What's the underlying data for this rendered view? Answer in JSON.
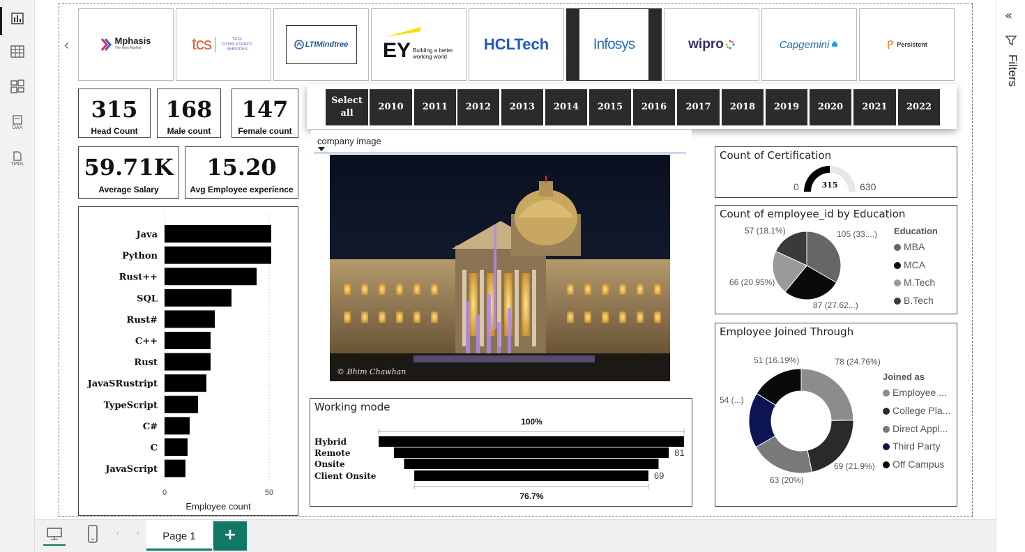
{
  "left_rail": {
    "items": [
      {
        "icon": "report-view-icon"
      },
      {
        "icon": "table-view-icon"
      },
      {
        "icon": "model-view-icon"
      },
      {
        "icon": "dax-query-icon",
        "label": "DAX"
      },
      {
        "icon": "tmdl-view-icon",
        "label": "TMDL"
      }
    ]
  },
  "right_pane": {
    "label": "Filters"
  },
  "logos": [
    "Mphasis",
    "The Next Applied",
    "tcs",
    "TATA CONSULTANCY SERVICES",
    "LTIMindtree",
    "EY",
    "Building a better working world",
    "HCLTech",
    "Infosys",
    "wipro",
    "Capgemini",
    "Persistent"
  ],
  "kpis": [
    {
      "value": "315",
      "label": "Head Count"
    },
    {
      "value": "168",
      "label": "Male count"
    },
    {
      "value": "147",
      "label": "Female count"
    },
    {
      "value": "59.71K",
      "label": "Average Salary"
    },
    {
      "value": "15.20",
      "label": "Avg Employee experience"
    }
  ],
  "year_slicer": {
    "select_all": "Select all",
    "years": [
      "2010",
      "2011",
      "2012",
      "2013",
      "2014",
      "2015",
      "2016",
      "2017",
      "2018",
      "2019",
      "2020",
      "2021",
      "2022"
    ]
  },
  "image_slicer": {
    "label": "company image",
    "watermark": "© Bhim Chawhan"
  },
  "languages_chart": {
    "chart_data": {
      "type": "bar",
      "orientation": "horizontal",
      "categories": [
        "Java",
        "Python",
        "Rust++",
        "SQL",
        "Rust#",
        "C++",
        "Rust",
        "JavaSRustript",
        "TypeScript",
        "C#",
        "C",
        "JavaScript"
      ],
      "values": [
        51,
        51,
        44,
        32,
        24,
        22,
        22,
        20,
        16,
        12,
        11,
        10
      ],
      "xlabel": "Employee count",
      "xticks": [
        "0",
        "50"
      ],
      "xlim": [
        0,
        55
      ],
      "grid": false
    }
  },
  "working_mode": {
    "title": "Working mode",
    "top_pct": "100%",
    "bottom_pct": "76.7%",
    "chart_data": {
      "type": "bar",
      "subtype": "funnel",
      "categories": [
        "Hybrid",
        "Remote",
        "Onsite",
        "Client Onsite"
      ],
      "values": [
        90,
        81,
        75,
        69
      ],
      "data_labels": [
        "",
        "81",
        "",
        "69"
      ]
    }
  },
  "certification": {
    "title": "Count of Certification",
    "min": "0",
    "max": "630",
    "value": "315",
    "chart_data": {
      "type": "gauge",
      "value": 315,
      "min": 0,
      "max": 630
    }
  },
  "education": {
    "title": "Count of employee_id by Education",
    "legend_title": "Education",
    "labels": [
      "105 (33....)",
      "87 (27.62...)",
      "66 (20.95%)",
      "57 (18.1%)"
    ],
    "chart_data": {
      "type": "pie",
      "categories": [
        "MBA",
        "MCA",
        "M.Tech",
        "B.Tech"
      ],
      "values": [
        105,
        87,
        66,
        57
      ],
      "colors": [
        "#666666",
        "#0a0a0a",
        "#9a9a9a",
        "#3a3a3a"
      ]
    }
  },
  "joined": {
    "title": "Employee Joined Through",
    "legend_title": "Joined as",
    "legend_labels": [
      "Employee ...",
      "College Pla...",
      "Direct Appl...",
      "Third Party",
      "Off Campus"
    ],
    "labels": [
      "78 (24.76%)",
      "69 (21.9%)",
      "63 (20%)",
      "54 (...)",
      "51 (16.19%)"
    ],
    "chart_data": {
      "type": "pie",
      "subtype": "donut",
      "categories": [
        "Employee ...",
        "College Pla...",
        "Direct Appl...",
        "Third Party",
        "Off Campus"
      ],
      "values": [
        78,
        69,
        63,
        54,
        51
      ],
      "colors": [
        "#8c8c8c",
        "#2a2a2a",
        "#7a7a7a",
        "#0d1452",
        "#0a0a0a"
      ]
    }
  },
  "bottom_bar": {
    "page_tab": "Page 1",
    "add_label": "+"
  }
}
